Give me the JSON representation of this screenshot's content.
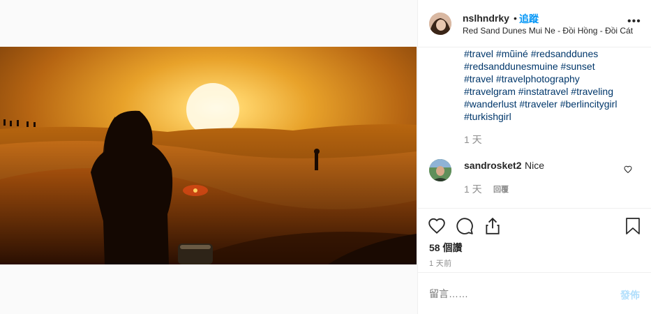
{
  "post": {
    "username": "nslhndrky",
    "separator": "•",
    "follow_label": "追蹤",
    "location": "Red Sand Dunes Mui Ne - Đồi Hồng - Đồi Cát",
    "more_label": "•••"
  },
  "caption": {
    "hashtag_lines": [
      "#travel #mũiné #redsanddunes",
      "#redsanddunesmuine #sunset",
      "#travel #travelphotography",
      "#travelgram #instatravel #traveling",
      "#wanderlust #traveler #berlincitygirl",
      "#turkishgirl"
    ],
    "time": "1 天"
  },
  "comment": {
    "username": "sandrosket2",
    "text": "Nice",
    "time": "1 天",
    "reply_label": "回覆"
  },
  "actions": {
    "likes": "58 個讚",
    "post_time": "1 天前"
  },
  "comment_box": {
    "placeholder": "留言……",
    "post_label": "發佈"
  },
  "icons": {
    "like": "heart-icon",
    "comment": "comment-bubble-icon",
    "share": "share-icon",
    "save": "bookmark-icon",
    "comment_like": "small-heart-icon",
    "more": "more-options-icon"
  },
  "colors": {
    "link_blue": "#0095f6",
    "hashtag_blue": "#00376b",
    "muted": "#8e8e8e",
    "post_disabled": "#b2dffc"
  }
}
